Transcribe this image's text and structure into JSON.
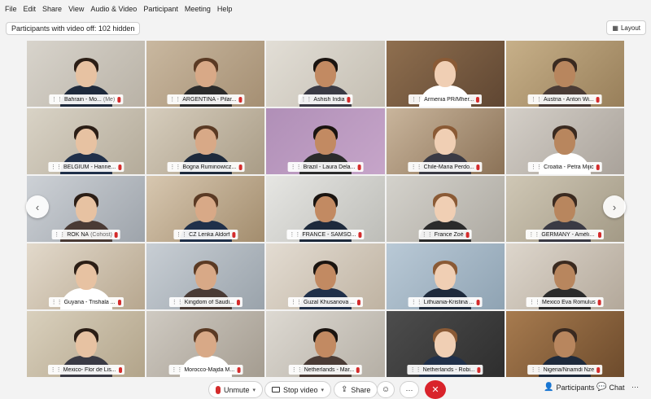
{
  "menu": [
    "File",
    "Edit",
    "Share",
    "View",
    "Audio & Video",
    "Participant",
    "Meeting",
    "Help"
  ],
  "hidden_label": "Participants with video off: 102 hidden",
  "layout_label": "Layout",
  "tiles": [
    {
      "name": "Bahrain - Mo...",
      "suffix": "(Me)"
    },
    {
      "name": "ARGENTINA - Pilar..."
    },
    {
      "name": "Ashish India"
    },
    {
      "name": "Armenia PR/Mher..."
    },
    {
      "name": "Austria - Anton Wi..."
    },
    {
      "name": "BELGIUM - Hanne..."
    },
    {
      "name": "Bogna Ruminowicz..."
    },
    {
      "name": "Brazil - Laura Dela..."
    },
    {
      "name": "Chile-Maria Perdo..."
    },
    {
      "name": "Croatia - Petra Mijic"
    },
    {
      "name": "ROK NA",
      "suffix": "(Cohost)"
    },
    {
      "name": "CZ Lenka Aldorf"
    },
    {
      "name": "FRANCE - SAMSO..."
    },
    {
      "name": "France Zoé"
    },
    {
      "name": "GERMANY - Amélie..."
    },
    {
      "name": "Guyana - Trishala ..."
    },
    {
      "name": "Kingdom of Saudi..."
    },
    {
      "name": "Guzal Khusanova ..."
    },
    {
      "name": "Lithuania-Kristina ..."
    },
    {
      "name": "Mexico Eva Romulus"
    },
    {
      "name": "Mexico- Flor de Lis..."
    },
    {
      "name": "Morocco-Majda M..."
    },
    {
      "name": "Netherlands - Mar..."
    },
    {
      "name": "Netherlands - Robi..."
    },
    {
      "name": "Nigeria/Nnamdi Nze"
    }
  ],
  "controls": {
    "unmute": "Unmute",
    "stop_video": "Stop video",
    "share": "Share",
    "participants": "Participants",
    "chat": "Chat"
  },
  "icons": {
    "nav_left": "chevron-left-icon",
    "nav_right": "chevron-right-icon",
    "end": "close-icon"
  }
}
